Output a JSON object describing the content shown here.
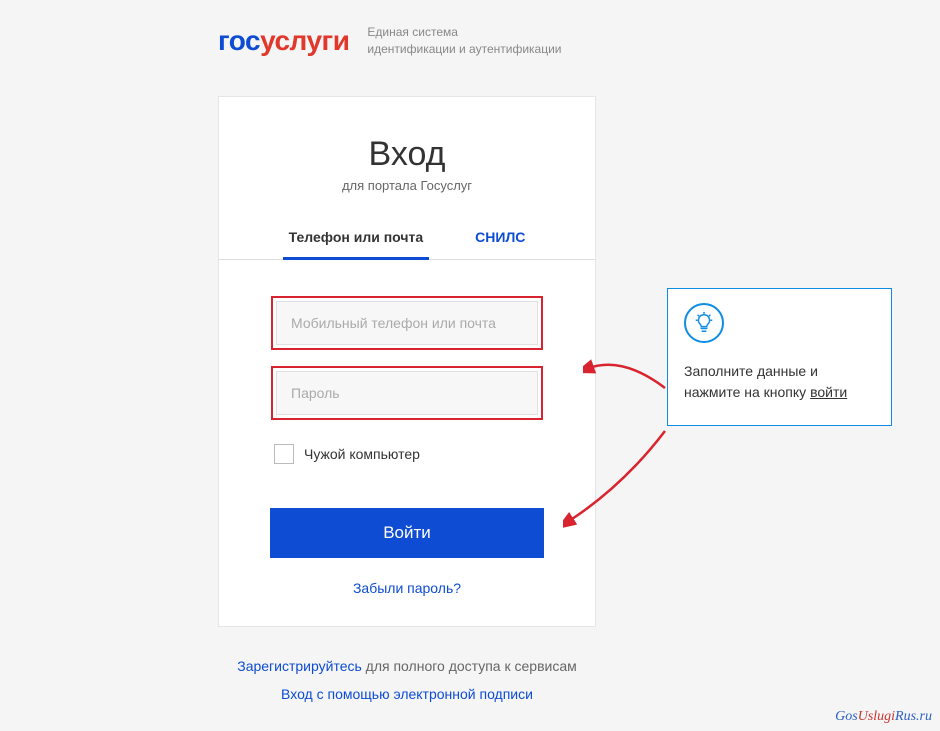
{
  "header": {
    "logo_blue": "гос",
    "logo_red": "услуги",
    "tagline_line1": "Единая система",
    "tagline_line2": "идентификации и аутентификации"
  },
  "card": {
    "title": "Вход",
    "subtitle": "для портала Госуслуг",
    "tabs": {
      "phone_email": "Телефон или почта",
      "snils": "СНИЛС"
    },
    "phone_placeholder": "Мобильный телефон или почта",
    "password_placeholder": "Пароль",
    "foreign_pc": "Чужой компьютер",
    "login_button": "Войти",
    "forgot": "Забыли пароль?"
  },
  "bottom": {
    "register_link": "Зарегистрируйтесь",
    "register_rest": " для полного доступа к сервисам",
    "esign": "Вход с помощью электронной подписи"
  },
  "tip": {
    "text_part1": "Заполните данные и нажмите на кнопку ",
    "text_link": "войти"
  },
  "watermark": {
    "p1": "Gos",
    "p2": "Uslugi",
    "p3": "Rus.ru"
  },
  "colors": {
    "primary_blue": "#0d4cd3",
    "accent_red": "#d9232e",
    "tip_border": "#0d8de3"
  }
}
